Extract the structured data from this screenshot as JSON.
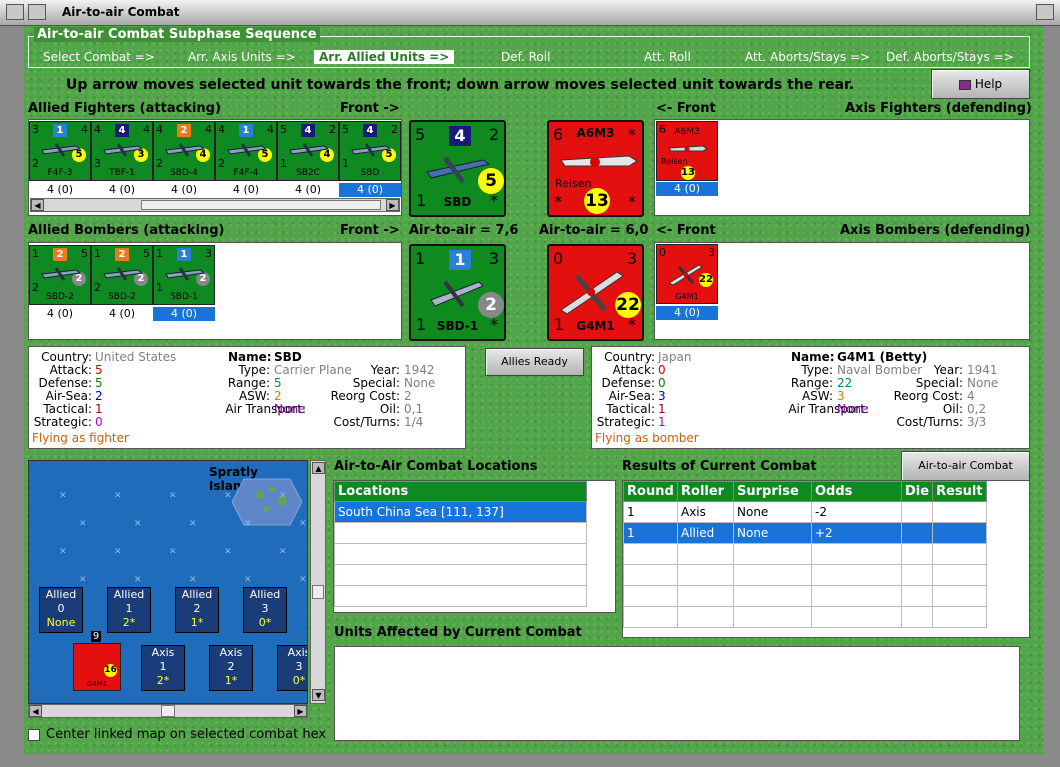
{
  "window": {
    "title": "Air-to-air Combat"
  },
  "sequence": {
    "legend": "Air-to-air Combat Subphase Sequence",
    "steps": [
      "Select Combat =>",
      "Arr. Axis Units =>",
      "Arr. Allied Units =>",
      "Def. Roll",
      "Att. Roll",
      "Att. Aborts/Stays =>",
      "Def. Aborts/Stays =>"
    ],
    "active_index": 2
  },
  "instruction": "Up arrow moves selected unit towards the front; down arrow moves selected unit towards the rear.",
  "help_label": "Help",
  "allied_fighters": {
    "title": "Allied Fighters (attacking)",
    "front": "Front ->",
    "units": [
      {
        "att": "3",
        "sq": "1",
        "sqcolor": "#2b7fd6",
        "def": "4",
        "tac": "5",
        "strat": "2",
        "name": "F4F-3",
        "sub": "4 (0)"
      },
      {
        "att": "4",
        "sq": "4",
        "sqcolor": "#1a1a7a",
        "def": "4",
        "tac": "3",
        "strat": "3",
        "name": "TBF-1",
        "sub": "4 (0)"
      },
      {
        "att": "4",
        "sq": "2",
        "sqcolor": "#e87b1c",
        "def": "4",
        "tac": "4",
        "strat": "2",
        "name": "SBD-4",
        "sub": "4 (0)"
      },
      {
        "att": "4",
        "sq": "1",
        "sqcolor": "#2b7fd6",
        "def": "4",
        "tac": "5",
        "strat": "2",
        "name": "F4F-4",
        "sub": "4 (0)"
      },
      {
        "att": "5",
        "sq": "4",
        "sqcolor": "#1a1a7a",
        "def": "2",
        "tac": "4",
        "strat": "1",
        "name": "SB2C",
        "sub": "4 (0)"
      },
      {
        "att": "5",
        "sq": "4",
        "sqcolor": "#1a1a7a",
        "def": "2",
        "tac": "5",
        "strat": "1",
        "name": "SBD",
        "sub": "4 (0)"
      }
    ]
  },
  "allied_bombers": {
    "title": "Allied Bombers (attacking)",
    "front": "Front ->",
    "units": [
      {
        "att": "1",
        "sq": "2",
        "sqcolor": "#e87b1c",
        "def": "5",
        "tac": "2",
        "strat": "2",
        "name": "SBD-2",
        "sub": "4 (0)"
      },
      {
        "att": "1",
        "sq": "2",
        "sqcolor": "#e87b1c",
        "def": "5",
        "tac": "2",
        "strat": "2",
        "name": "SBD-2",
        "sub": "4 (0)"
      },
      {
        "att": "1",
        "sq": "1",
        "sqcolor": "#2b7fd6",
        "def": "3",
        "tac": "2",
        "strat": "1",
        "name": "SBD-1",
        "sub": "4 (0)"
      }
    ]
  },
  "axis_fighters": {
    "title": "Axis Fighters (defending)",
    "front": "<- Front",
    "units": [
      {
        "att": "6",
        "name": "A6M3",
        "label": "Reisen",
        "dot": "13",
        "sub": "4 (0)"
      }
    ]
  },
  "axis_bombers": {
    "title": "Axis Bombers (defending)",
    "front": "<- Front",
    "units": [
      {
        "att": "0",
        "def": "3",
        "name": "G4M1",
        "dot": "22",
        "sub": "4 (0)"
      }
    ]
  },
  "big": {
    "allied_fighter": {
      "att": "5",
      "sq": "4",
      "def": "2",
      "dot": "5",
      "name": "SBD",
      "b1": "1",
      "b2": "*"
    },
    "axis_fighter": {
      "att": "6",
      "name": "A6M3",
      "label": "Reisen",
      "dot": "13",
      "b1": "*",
      "b2": "*",
      "tr": "*"
    },
    "allied_bomber": {
      "att": "1",
      "sq": "1",
      "def": "3",
      "dot": "2",
      "name": "SBD-1",
      "b1": "1",
      "b2": "*",
      "a2a": "Air-to-air = 7,6"
    },
    "axis_bomber": {
      "att": "0",
      "def": "3",
      "dot": "22",
      "name": "G4M1",
      "b1": "1",
      "b2": "*",
      "a2a": "Air-to-air = 6,0"
    }
  },
  "allied_info": {
    "country_l": "Country:",
    "country": "United States",
    "name_l": "Name:",
    "name": "SBD",
    "attack_l": "Attack:",
    "attack": "5",
    "type_l": "Type:",
    "type": "Carrier Plane",
    "year_l": "Year:",
    "year": "1942",
    "defense_l": "Defense:",
    "defense": "5",
    "range_l": "Range:",
    "range": "5",
    "special_l": "Special:",
    "special": "None",
    "airsea_l": "Air-Sea:",
    "airsea": "2",
    "asw_l": "ASW:",
    "asw": "2",
    "reorg_l": "Reorg Cost:",
    "reorg": "2",
    "tactical_l": "Tactical:",
    "tactical": "1",
    "airtrans_l": "Air Transport:",
    "airtrans": "None",
    "oil_l": "Oil:",
    "oil": "0,1",
    "strategic_l": "Strategic:",
    "strategic": "0",
    "cost_l": "Cost/Turns:",
    "cost": "1/4",
    "flying": "Flying as fighter"
  },
  "axis_info": {
    "country_l": "Country:",
    "country": "Japan",
    "name_l": "Name:",
    "name": "G4M1 (Betty)",
    "attack_l": "Attack:",
    "attack": "0",
    "type_l": "Type:",
    "type": "Naval Bomber",
    "year_l": "Year:",
    "year": "1941",
    "defense_l": "Defense:",
    "defense": "0",
    "range_l": "Range:",
    "range": "22",
    "special_l": "Special:",
    "special": "None",
    "airsea_l": "Air-Sea:",
    "airsea": "3",
    "asw_l": "ASW:",
    "asw": "3",
    "reorg_l": "Reorg Cost:",
    "reorg": "4",
    "tactical_l": "Tactical:",
    "tactical": "1",
    "airtrans_l": "Air Transport:",
    "airtrans": "None",
    "oil_l": "Oil:",
    "oil": "0,2",
    "strategic_l": "Strategic:",
    "strategic": "1",
    "cost_l": "Cost/Turns:",
    "cost": "3/3",
    "flying": "Flying as bomber"
  },
  "allies_ready": "Allies Ready",
  "map": {
    "title": "Spratly Islands",
    "allied": [
      {
        "label": "Allied",
        "n": "0",
        "v": "None"
      },
      {
        "label": "Allied",
        "n": "1",
        "v": "2*"
      },
      {
        "label": "Allied",
        "n": "2",
        "v": "1*"
      },
      {
        "label": "Allied",
        "n": "3",
        "v": "0*"
      }
    ],
    "axis": [
      {
        "label": "Axis",
        "n": "1",
        "v": "2*"
      },
      {
        "label": "Axis",
        "n": "2",
        "v": "1*"
      },
      {
        "label": "Axis",
        "n": "3",
        "v": "0*"
      }
    ],
    "stack_count": "9",
    "stack_unit": "G4M1",
    "stack_dot": "16"
  },
  "locations": {
    "title": "Air-to-Air Combat Locations",
    "header": "Locations",
    "rows": [
      "South China Sea [111, 137]"
    ]
  },
  "results": {
    "title": "Results of Current Combat",
    "chart_btn": "Air-to-air Combat Chart",
    "headers": [
      "Round",
      "Roller",
      "Surprise",
      "Odds",
      "Die",
      "Result"
    ],
    "rows": [
      [
        "1",
        "Axis",
        "None",
        "-2",
        "",
        ""
      ],
      [
        "1",
        "Allied",
        "None",
        "+2",
        "",
        ""
      ]
    ],
    "selected_row": 1
  },
  "affected_title": "Units Affected by Current Combat",
  "center_checkbox": "Center linked map on selected combat hex"
}
